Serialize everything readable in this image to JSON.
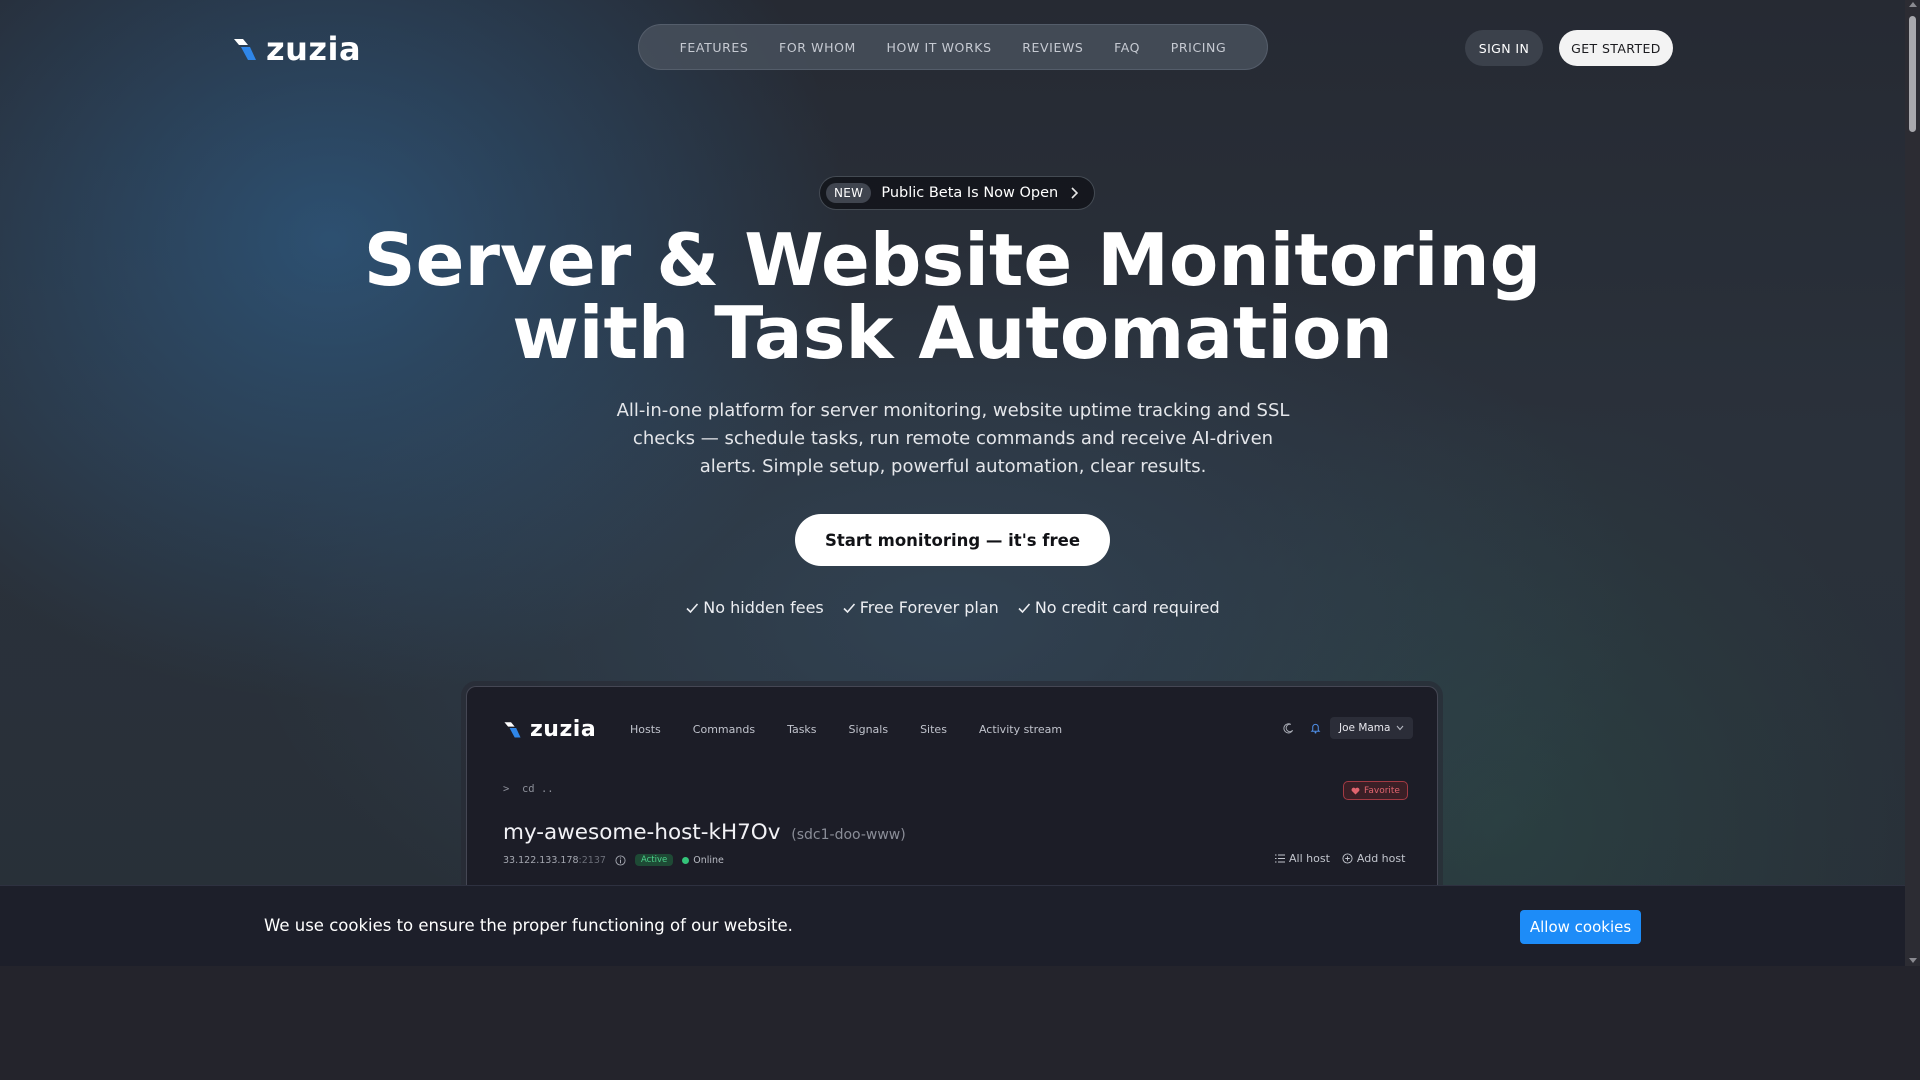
{
  "brand": {
    "name": "zuzia",
    "mark_colors": [
      "#ffffff",
      "#2f86e8"
    ]
  },
  "nav": {
    "items": [
      "FEATURES",
      "FOR WHOM",
      "HOW IT WORKS",
      "REVIEWS",
      "FAQ",
      "PRICING"
    ]
  },
  "header": {
    "sign_in": "SIGN IN",
    "get_started": "GET STARTED"
  },
  "hero": {
    "badge_tag": "NEW",
    "badge_text": "Public Beta Is Now Open",
    "title_line1": "Server & Website Monitoring",
    "title_line2": "with Task Automation",
    "subtitle": "All-in-one platform for server monitoring, website uptime tracking and SSL checks — schedule tasks, run remote commands and receive AI-driven alerts. Simple setup, powerful automation, clear results.",
    "cta": "Start monitoring — it's free",
    "perks": [
      "No hidden fees",
      "Free Forever plan",
      "No credit card required"
    ]
  },
  "preview": {
    "nav": [
      "Hosts",
      "Commands",
      "Tasks",
      "Signals",
      "Sites",
      "Activity stream"
    ],
    "user": "Joe Mama",
    "breadcrumb": "cd ..",
    "favorite": "Favorite",
    "host_name": "my-awesome-host-kH7Ov",
    "host_alias": "(sdc1-doo-www)",
    "host_ip": "33.122.133.178",
    "host_port": ":2137",
    "status_badge": "Active",
    "online": "Online",
    "all_host": "All host",
    "add_host": "Add host"
  },
  "cookie": {
    "text": "We use cookies to ensure the proper functioning of our website.",
    "button": "Allow cookies"
  },
  "colors": {
    "accent_blue": "#1d8cf8",
    "favorite_red": "#e0646e",
    "active_green": "#4bd08a"
  }
}
